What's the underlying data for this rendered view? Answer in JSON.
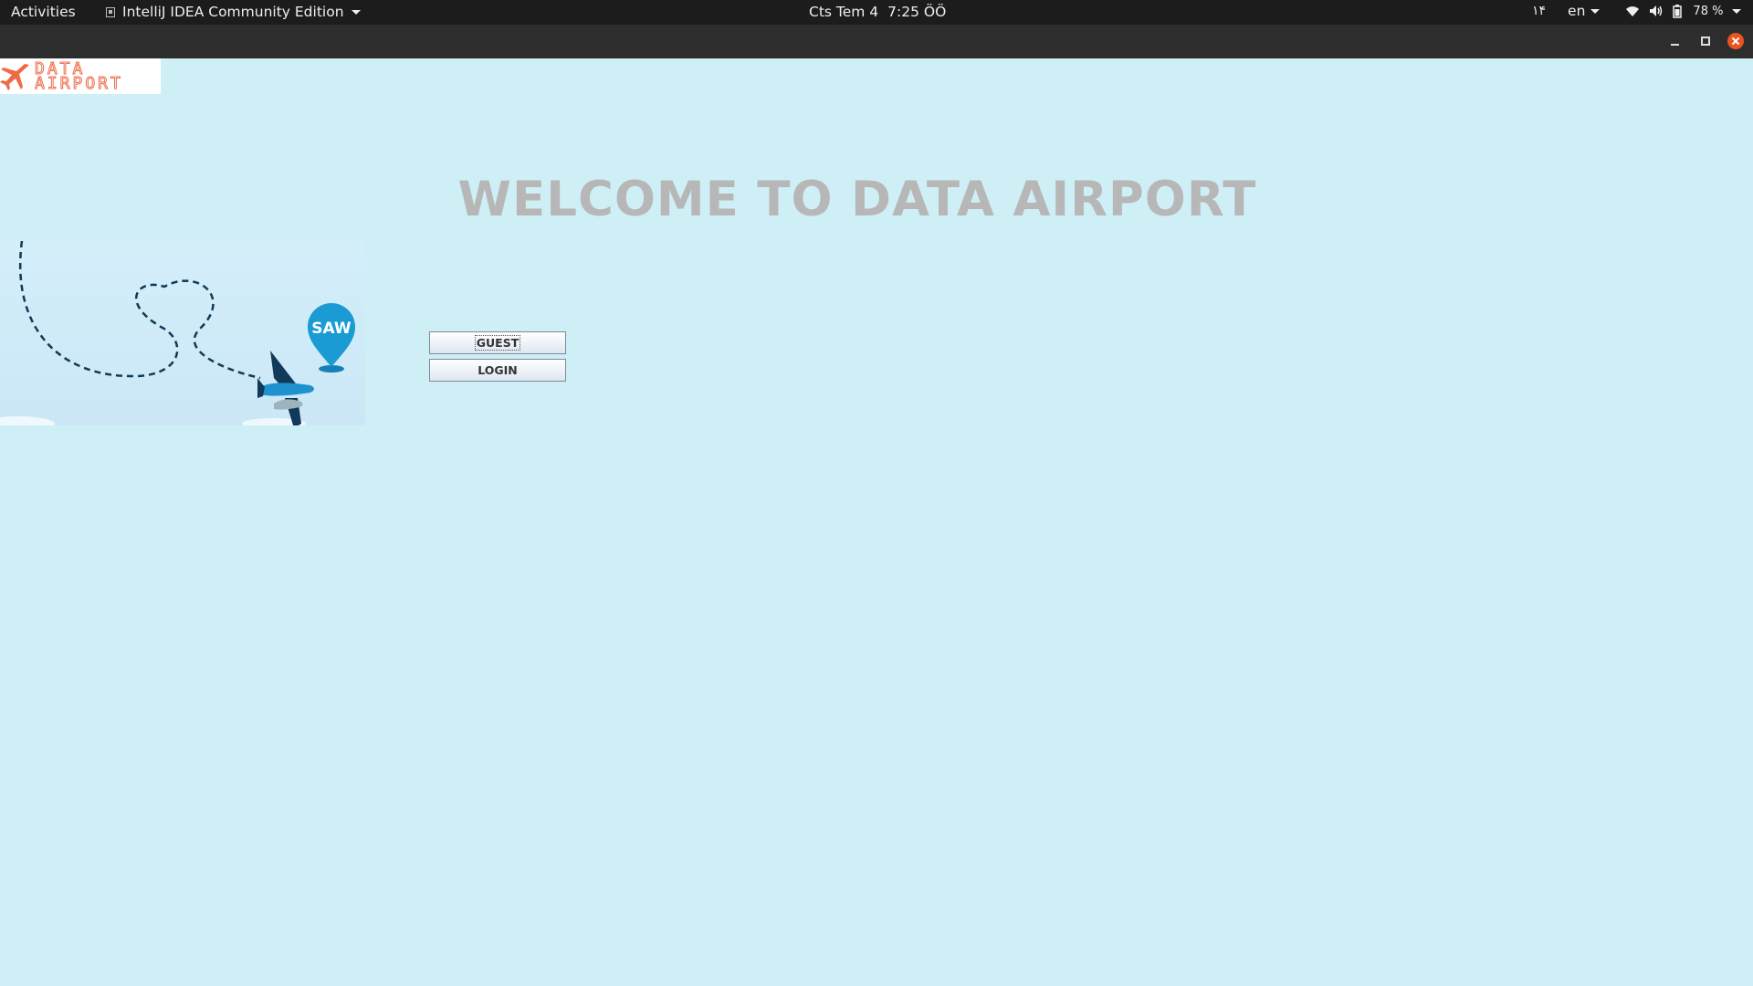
{
  "topbar": {
    "activities": "Activities",
    "app_name": "IntelliJ IDEA Community Edition",
    "date": "Cts Tem 4",
    "time": "7:25 ÖÖ",
    "indicator": "۱۴",
    "language": "en",
    "battery": "78 %"
  },
  "app": {
    "logo_line1": "DATA",
    "logo_line2": "AIRPORT",
    "welcome": "WELCOME TO DATA AIRPORT",
    "pin_label": "SAW",
    "buttons": {
      "guest": "GUEST",
      "login": "LOGIN"
    }
  },
  "colors": {
    "background": "#cfeff6",
    "welcome_text": "#b7b7b7",
    "logo_accent": "#ee6b47",
    "pin": "#1a9bd4",
    "plane_dark": "#10395a"
  }
}
